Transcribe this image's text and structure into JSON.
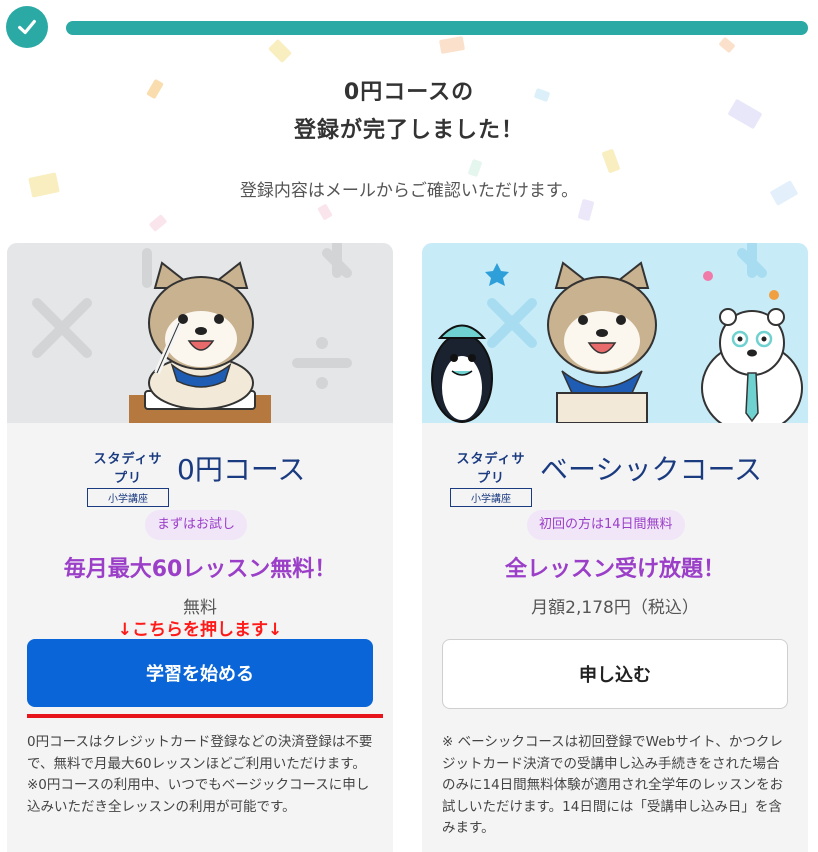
{
  "header": {
    "progress_percent": 100,
    "accent_color": "#2aa9a5"
  },
  "completion": {
    "title_line1": "0円コースの",
    "title_line2": "登録が完了しました！",
    "subtitle": "登録内容はメールからご確認いただけます。"
  },
  "cards": [
    {
      "brand_main": "スタディサプリ",
      "brand_sub": "小学講座",
      "course_name": "0円コース",
      "badge": "まずはお試し",
      "headline": "毎月最大60レッスン無料！",
      "price": "無料",
      "annotation": "↓こちらを押します↓",
      "button_label": "学習を始める",
      "notes": [
        "0円コースはクレジットカード登録などの決済登録は不要で、無料で月最大60レッスンほどご利用いただけます。",
        "※0円コースの利用中、いつでもベージックコースに申し込みいただき全レッスンの利用が可能です。"
      ]
    },
    {
      "brand_main": "スタディサプリ",
      "brand_sub": "小学講座",
      "course_name": "ベーシックコース",
      "badge": "初回の方は14日間無料",
      "headline": "全レッスン受け放題！",
      "price": "月額2,178円（税込）",
      "button_label": "申し込む",
      "notes": [
        "※ ベーシックコースは初回登録でWebサイト、かつクレジットカード決済での受講申し込み手続きをされた場合のみに14日間無料体験が適用され全学年のレッスンをお試しいただけます。14日間には「受講申し込み日」を含みます。"
      ]
    }
  ],
  "colors": {
    "primary_button": "#0a66d8",
    "purple": "#9b3fc8",
    "navy": "#1b3b80",
    "annotation_red": "#ff1a1a"
  }
}
